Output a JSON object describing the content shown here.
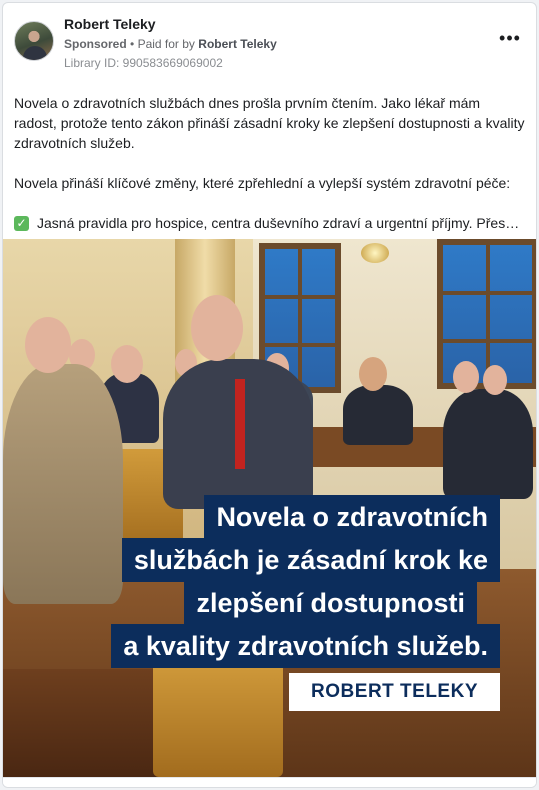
{
  "post": {
    "author": "Robert Teleky",
    "sponsored_label": "Sponsored",
    "separator": "•",
    "paid_for_text": "Paid for by",
    "payer": "Robert Teleky",
    "library_id": "Library ID: 990583669069002",
    "more_icon": "more-horizontal-icon",
    "more_label": "•••"
  },
  "text": {
    "paragraph1": "Novela o zdravotních službách dnes prošla prvním čtením. Jako lékař mám radost, protože tento zákon přináší zásadní kroky ke zlepšení dostupnosti a kvality zdravotních služeb.",
    "paragraph2": "Novela přináší klíčové změny, které zpřehlední a vylepší systém zdravotní péče:",
    "bullet1_icon": "check-mark-icon",
    "bullet1_glyph": "✓",
    "bullet1": "Jasná pravidla pro hospice, centra duševního zdraví a urgentní příjmy. Přesné…"
  },
  "image": {
    "banner_lines": [
      "Novela o zdravotních",
      "službách je zásadní krok ke",
      "zlepšení dostupnosti",
      "a kvality zdravotních služeb."
    ],
    "signature": "ROBERT TELEKY",
    "colors": {
      "banner_bg": "#0c2d5c",
      "banner_text": "#ffffff",
      "tie": "#c2231f"
    }
  }
}
